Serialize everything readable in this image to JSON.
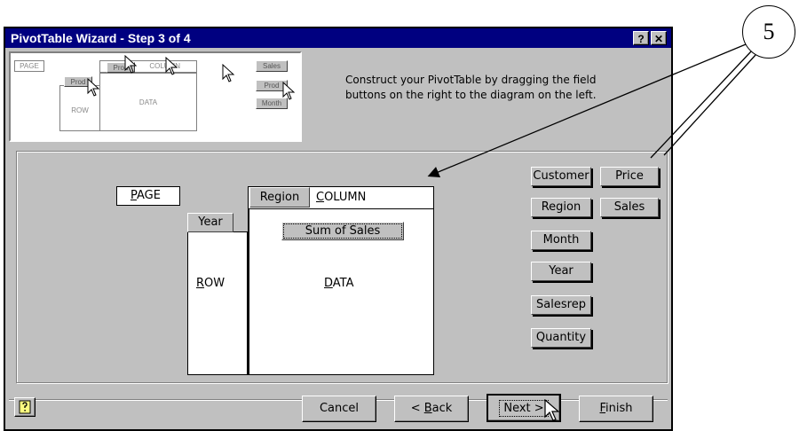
{
  "window": {
    "title": "PivotTable Wizard - Step 3 of 4",
    "help_glyph": "?",
    "close_glyph": "✕"
  },
  "preview": {
    "page": "PAGE",
    "column": "COLUMN",
    "row": "ROW",
    "data": "DATA",
    "field_a": "Prod",
    "field_b": "Prod",
    "btn_1": "Sales",
    "btn_2": "Prod",
    "btn_3": "Month"
  },
  "instructions": "Construct your PivotTable by dragging the field buttons on the right to the diagram on the left.",
  "layout": {
    "page_prefix": "P",
    "page_rest": "AGE",
    "row_prefix": "R",
    "row_rest": "OW",
    "column_prefix": "C",
    "column_rest": "OLUMN",
    "data_prefix": "D",
    "data_rest": "ATA",
    "row_field": "Year",
    "column_field": "Region",
    "data_field": "Sum of Sales"
  },
  "fields": [
    "Customer",
    "Price",
    "Region",
    "Sales",
    "Month",
    "Year",
    "Salesrep",
    "Quantity"
  ],
  "buttons": {
    "cancel": "Cancel",
    "back_prefix": "< ",
    "back_key": "B",
    "back_rest": "ack",
    "next": "Next >",
    "finish_key": "F",
    "finish_rest": "inish"
  },
  "annotation": {
    "label": "5"
  },
  "colors": {
    "title_bar": "#000080",
    "dialog_face": "#c0c0c0"
  },
  "icons": [
    "help-book-icon",
    "mouse-pointer-icon"
  ]
}
